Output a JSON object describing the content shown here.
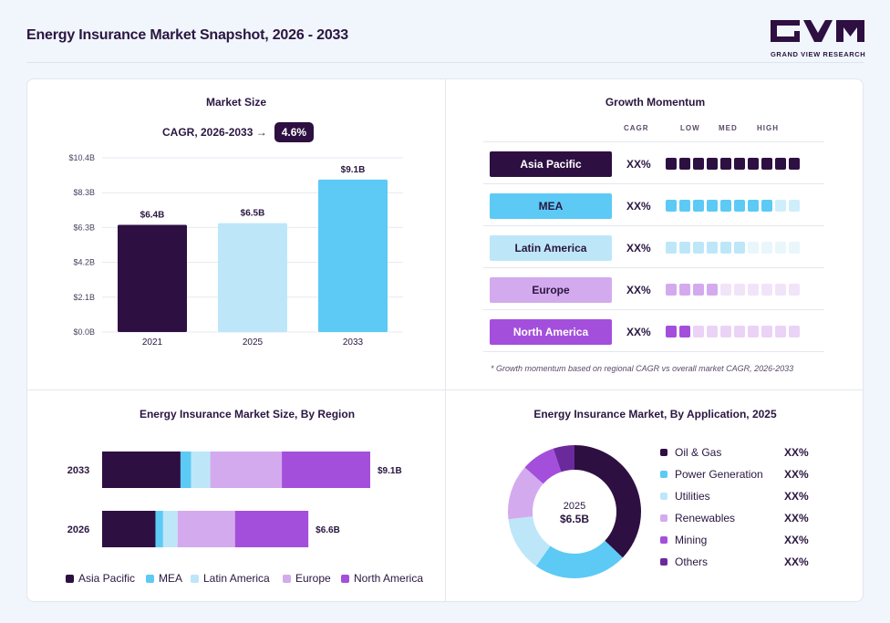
{
  "header": {
    "title": "Energy Insurance Market Snapshot, 2026 - 2033",
    "logo_text": "GRAND VIEW RESEARCH"
  },
  "market_size": {
    "title": "Market Size",
    "cagr_label": "CAGR, 2026-2033 →",
    "cagr_value": "4.6%"
  },
  "growth": {
    "title": "Growth Momentum",
    "headers": {
      "cagr": "CAGR",
      "low": "LOW",
      "med": "MED",
      "high": "HIGH"
    },
    "rows": [
      {
        "region": "Asia Pacific",
        "value": "XX%",
        "level": 10,
        "color": "#2e0f42",
        "light": "#2e0f42",
        "text": "#ffffff"
      },
      {
        "region": "MEA",
        "value": "XX%",
        "level": 8,
        "color": "#5ccaf5",
        "light": "#cfeefb",
        "text": "#2a1640"
      },
      {
        "region": "Latin America",
        "value": "XX%",
        "level": 6,
        "color": "#bde7f8",
        "light": "#e9f6fc",
        "text": "#2a1640"
      },
      {
        "region": "Europe",
        "value": "XX%",
        "level": 4,
        "color": "#d4aaee",
        "light": "#f1e4f9",
        "text": "#2a1640"
      },
      {
        "region": "North America",
        "value": "XX%",
        "level": 2,
        "color": "#a44fdc",
        "light": "#ead3f6",
        "text": "#ffffff"
      }
    ],
    "note": "* Growth momentum based on regional CAGR vs overall market CAGR, 2026-2033"
  },
  "region_panel": {
    "title": "Energy Insurance Market Size, By Region"
  },
  "application_panel": {
    "title": "Energy Insurance Market, By Application, 2025",
    "center_year": "2025",
    "center_value": "$6.5B"
  },
  "chart_data": [
    {
      "type": "bar",
      "title": "Market Size",
      "categories": [
        "2021",
        "2025",
        "2033"
      ],
      "values": [
        6.4,
        6.5,
        9.1
      ],
      "data_labels": [
        "$6.4B",
        "$6.5B",
        "$9.1B"
      ],
      "colors": [
        "#2e0f42",
        "#bde7f8",
        "#5ccaf5"
      ],
      "ylim": [
        0,
        10.4
      ],
      "yticks": [
        "$0.0B",
        "$2.1B",
        "$4.2B",
        "$6.3B",
        "$8.3B",
        "$10.4B"
      ],
      "grid": true
    },
    {
      "type": "bar",
      "orientation": "horizontal",
      "stacked": true,
      "title": "Energy Insurance Market Size, By Region",
      "categories": [
        "2033",
        "2026"
      ],
      "totals": [
        9.1,
        6.6
      ],
      "total_labels": [
        "$9.1B",
        "$6.6B"
      ],
      "series": [
        {
          "name": "Asia Pacific",
          "color": "#2e0f42",
          "values": [
            2.66,
            1.81
          ]
        },
        {
          "name": "MEA",
          "color": "#5ccaf5",
          "values": [
            0.36,
            0.26
          ]
        },
        {
          "name": "Latin America",
          "color": "#bde7f8",
          "values": [
            0.65,
            0.49
          ]
        },
        {
          "name": "Europe",
          "color": "#d4aaee",
          "values": [
            2.43,
            1.95
          ]
        },
        {
          "name": "North America",
          "color": "#a44fdc",
          "values": [
            3.0,
            2.49
          ]
        }
      ],
      "legend_position": "bottom"
    },
    {
      "type": "pie",
      "donut": true,
      "title": "Energy Insurance Market, By Application, 2025",
      "labels": [
        "Oil & Gas",
        "Power Generation",
        "Utilities",
        "Renewables",
        "Mining",
        "Others"
      ],
      "values": [
        36,
        22,
        13,
        13,
        8,
        5
      ],
      "value_labels": [
        "XX%",
        "XX%",
        "XX%",
        "XX%",
        "XX%",
        "XX%"
      ],
      "colors": [
        "#2e0f42",
        "#5ccaf5",
        "#bde7f8",
        "#d4aaee",
        "#a44fdc",
        "#6a2a9c"
      ],
      "legend_position": "right"
    }
  ]
}
